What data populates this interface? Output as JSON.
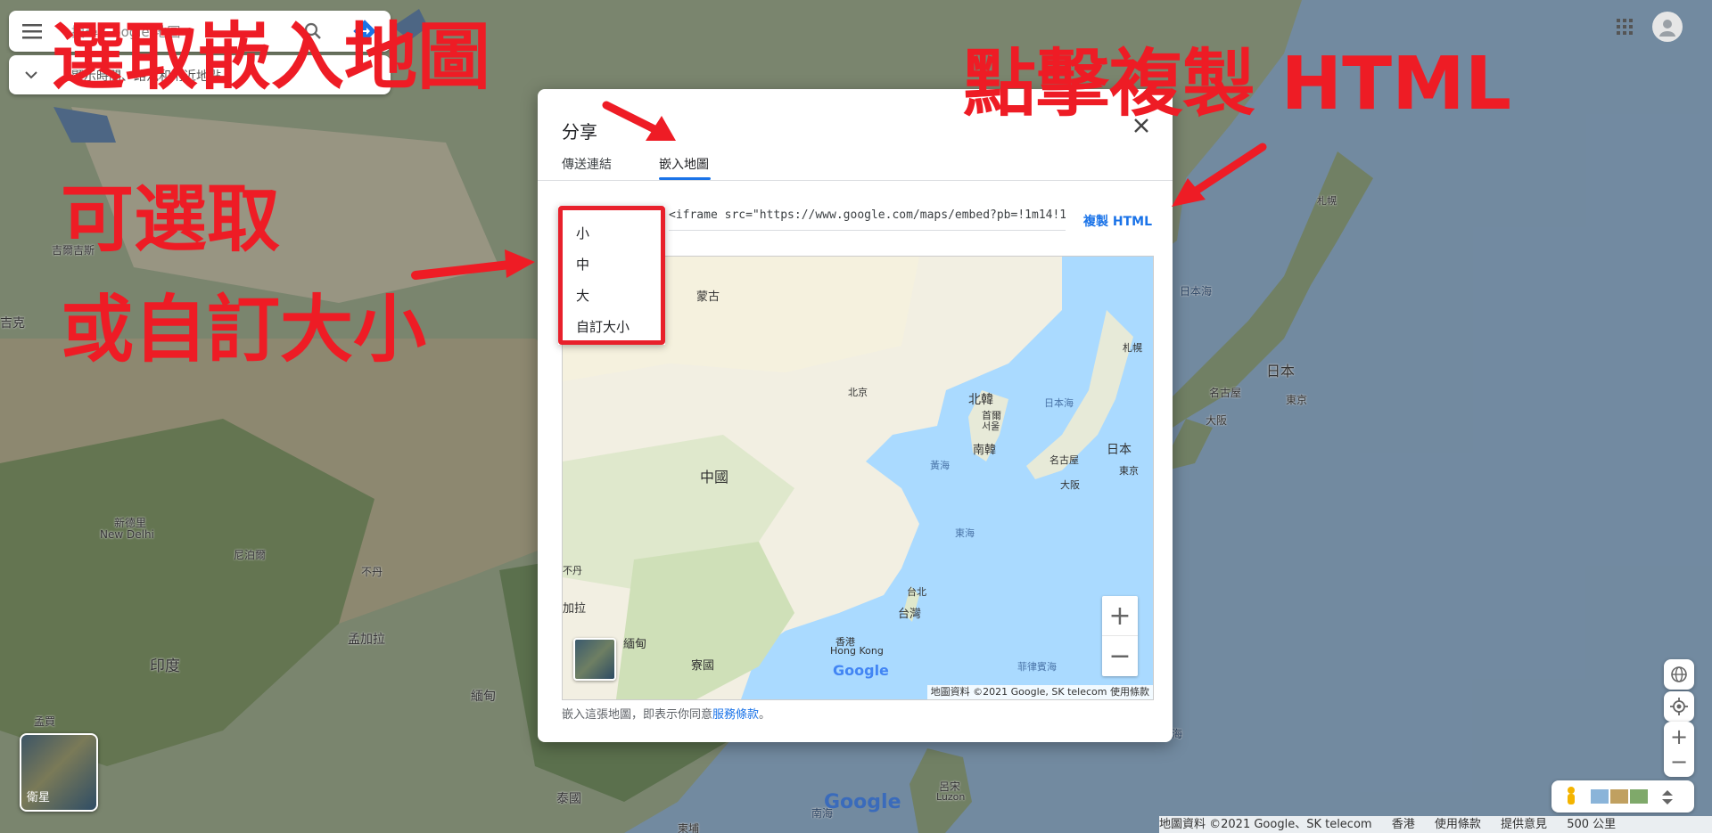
{
  "map": {
    "search_placeholder": "搜尋 Google 地圖",
    "route_text": "顯示時間、路況和附近地點",
    "labels": {
      "mongolia": "蒙古",
      "tehran_region": "吉爾吉斯",
      "afgh": "吉克",
      "new_delhi_zh": "新德里",
      "new_delhi_en": "New Delhi",
      "nepal": "尼泊爾",
      "bhutan": "不丹",
      "bangladesh": "孟加拉",
      "india": "印度",
      "myanmar": "緬甸",
      "thailand": "泰國",
      "sapporo": "札幌",
      "sea_of_japan": "日本海",
      "japan": "日本",
      "nagoya": "名古屋",
      "osaka": "大阪",
      "tokyo": "東京",
      "luzon_zh": "呂宋",
      "luzon_en": "Luzon",
      "south_sea": "南海",
      "pakistan": "孟買",
      "cambodia": "柬埔",
      "sea_right": "海"
    },
    "satellite_label": "衛星",
    "footer": [
      "地圖資料 ©2021 Google、SK telecom",
      "香港",
      "使用條款",
      "提供意見",
      "500 公里"
    ],
    "google_logo": "Google"
  },
  "dialog": {
    "title": "分享",
    "tabs": [
      {
        "label": "傳送連結",
        "active": false
      },
      {
        "label": "嵌入地圖",
        "active": true
      }
    ],
    "embed_code": "<iframe src=\"https://www.google.com/maps/embed?pb=!1m14!1m12!1m3!1d1",
    "copy_label": "複製 HTML",
    "terms_prefix": "嵌入這張地圖，即表示你同意",
    "terms_link": "服務條款",
    "terms_suffix": "。",
    "size_options": [
      "小",
      "中",
      "大",
      "自訂大小"
    ],
    "preview": {
      "labels": {
        "mongolia": "蒙古",
        "beijing": "北京",
        "north_korea": "北韓",
        "seoul_1": "首爾",
        "seoul_2": "서울",
        "south_korea": "南韓",
        "sea_of_japan": "日本海",
        "japan": "日本",
        "nagoya": "名古屋",
        "tokyo": "東京",
        "osaka": "大阪",
        "sapporo": "札幌",
        "yellow_sea": "黃海",
        "east_sea": "東海",
        "china": "中國",
        "taipei": "台北",
        "taiwan": "台灣",
        "hongkong_zh": "香港",
        "hongkong_en": "Hong Kong",
        "philippine_sea": "菲律賓海",
        "myanmar": "緬甸",
        "laos": "寮國",
        "bangla": "加拉",
        "bhutan": "不丹"
      },
      "footer": "地圖資料 ©2021 Google, SK telecom  使用條款",
      "google_logo": "Google"
    }
  },
  "annotations": {
    "select_embed": "選取嵌入地圖",
    "click_copy": "點擊複製 HTML",
    "selectable_line1": "可選取",
    "selectable_line2": "或自訂大小"
  },
  "colors": {
    "annotation_red": "#ee1c25",
    "link_blue": "#1a73e8",
    "water": "#aadaff",
    "land": "#e8ecd8"
  }
}
